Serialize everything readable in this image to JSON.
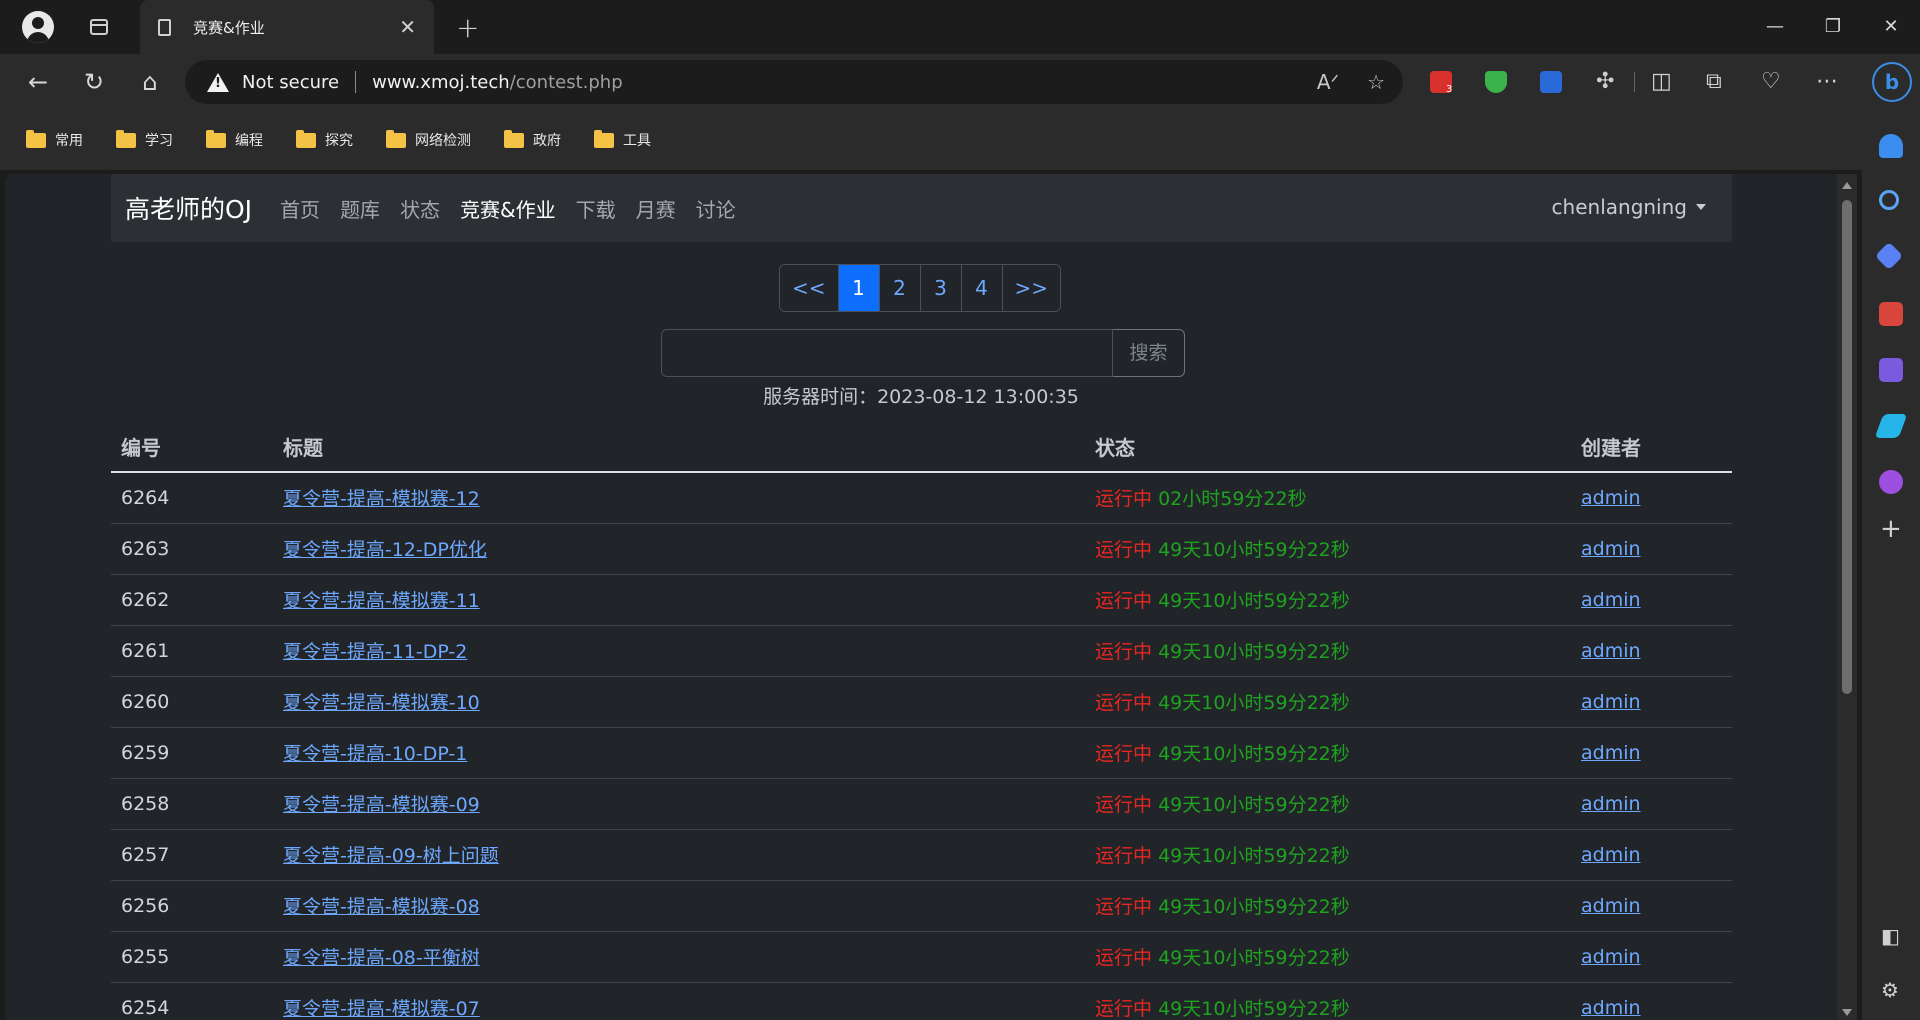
{
  "browser": {
    "tab_title": "竞赛&作业",
    "address_warning": "Not secure",
    "url_host": "www.xmoj.tech",
    "url_path": "/contest.php",
    "extension_badge": "3",
    "bookmarks": [
      "常用",
      "学习",
      "编程",
      "探究",
      "网络检测",
      "政府",
      "工具"
    ]
  },
  "site": {
    "brand": "高老师的OJ",
    "nav": [
      "首页",
      "题库",
      "状态",
      "竞赛&作业",
      "下载",
      "月赛",
      "讨论"
    ],
    "user": "chenlangning"
  },
  "pagination": [
    "<<",
    "1",
    "2",
    "3",
    "4",
    ">>"
  ],
  "search": {
    "button": "搜索",
    "value": ""
  },
  "server_time": "服务器时间：2023-08-12 13:00:35",
  "table": {
    "headers": [
      "编号",
      "标题",
      "状态",
      "创建者"
    ],
    "rows": [
      {
        "id": "6264",
        "title": "夏令营-提高-模拟赛-12",
        "status": "运行中",
        "remaining": "02小时59分22秒",
        "creator": "admin"
      },
      {
        "id": "6263",
        "title": "夏令营-提高-12-DP优化",
        "status": "运行中",
        "remaining": "49天10小时59分22秒",
        "creator": "admin"
      },
      {
        "id": "6262",
        "title": "夏令营-提高-模拟赛-11",
        "status": "运行中",
        "remaining": "49天10小时59分22秒",
        "creator": "admin"
      },
      {
        "id": "6261",
        "title": "夏令营-提高-11-DP-2",
        "status": "运行中",
        "remaining": "49天10小时59分22秒",
        "creator": "admin"
      },
      {
        "id": "6260",
        "title": "夏令营-提高-模拟赛-10",
        "status": "运行中",
        "remaining": "49天10小时59分22秒",
        "creator": "admin"
      },
      {
        "id": "6259",
        "title": "夏令营-提高-10-DP-1",
        "status": "运行中",
        "remaining": "49天10小时59分22秒",
        "creator": "admin"
      },
      {
        "id": "6258",
        "title": "夏令营-提高-模拟赛-09",
        "status": "运行中",
        "remaining": "49天10小时59分22秒",
        "creator": "admin"
      },
      {
        "id": "6257",
        "title": "夏令营-提高-09-树上问题",
        "status": "运行中",
        "remaining": "49天10小时59分22秒",
        "creator": "admin"
      },
      {
        "id": "6256",
        "title": "夏令营-提高-模拟赛-08",
        "status": "运行中",
        "remaining": "49天10小时59分22秒",
        "creator": "admin"
      },
      {
        "id": "6255",
        "title": "夏令营-提高-08-平衡树",
        "status": "运行中",
        "remaining": "49天10小时59分22秒",
        "creator": "admin"
      },
      {
        "id": "6254",
        "title": "夏令营-提高-模拟赛-07",
        "status": "运行中",
        "remaining": "49天10小时59分22秒",
        "creator": "admin"
      }
    ]
  },
  "colors": {
    "status_running": "#e8261f",
    "remaining_time": "#1fa21f",
    "link": "#6ea8fe",
    "active_page": "#0d6efd"
  }
}
